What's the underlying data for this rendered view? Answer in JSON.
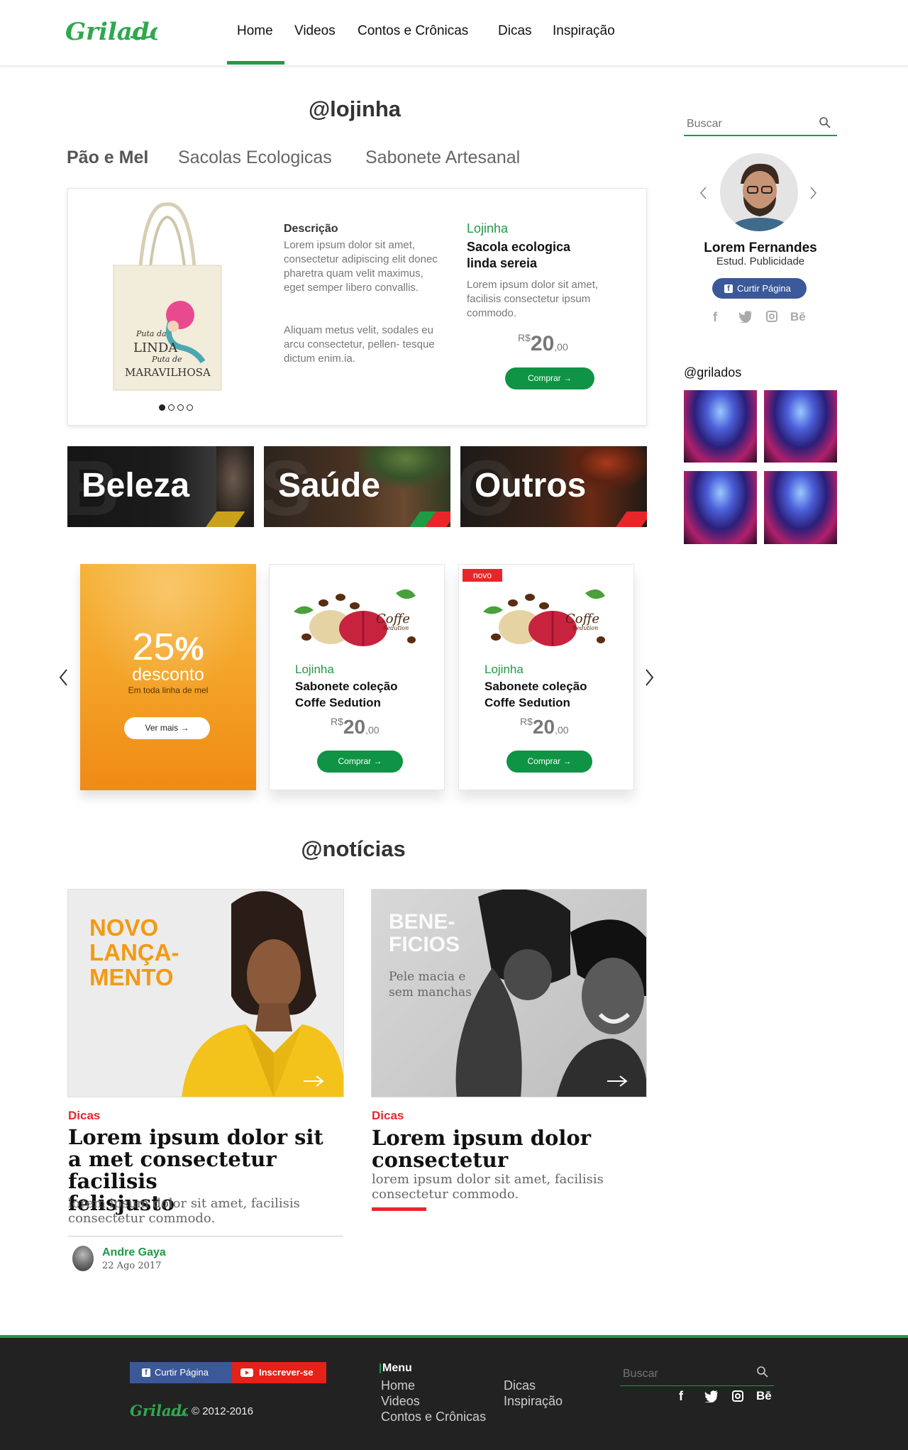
{
  "colors": {
    "brand_green": "#1e9b45",
    "button_green": "#0e9444",
    "accent_red": "#e8262a",
    "footer_bg": "#222222",
    "promo_orange": "#f29a1d"
  },
  "header": {
    "logo": "Grilados",
    "nav": [
      "Home",
      "Videos",
      "Contos e Crônicas",
      "Dicas",
      "Inspiração"
    ],
    "active": "Home"
  },
  "shop": {
    "title": "@lojinha",
    "tabs": [
      "Pão e Mel",
      "Sacolas Ecologicas",
      "Sabonete Artesanal"
    ],
    "featured": {
      "image_text": [
        "Puta da",
        "LINDA",
        "Puta de",
        "MARAVILHOSA"
      ],
      "desc_title": "Descrição",
      "desc_p1": "Lorem ipsum dolor sit amet, consectetur adipiscing elit donec pharetra quam velit maximus, eget semper libero convallis.",
      "desc_p2": "Aliquam metus velit, sodales eu arcu consectetur, pellen- tesque dictum enim.ia.",
      "store": "Lojinha",
      "name_line1": "Sacola ecologica",
      "name_line2": "linda sereia",
      "summary": "Lorem ipsum dolor sit amet, facilisis consectetur ipsum commodo.",
      "price_currency": "R$",
      "price_int": "20",
      "price_cents": ",00",
      "button": "Comprar →",
      "carousel_dots": 4,
      "carousel_active": 1
    },
    "categories": [
      {
        "label": "Beleza",
        "ghost": "B"
      },
      {
        "label": "Saúde",
        "ghost": "S"
      },
      {
        "label": "Outros",
        "ghost": "O"
      }
    ],
    "promo": {
      "percent": "25",
      "percent_sign": "%",
      "word": "desconto",
      "subtitle": "Em toda linha de mel",
      "button": "Ver mais →"
    },
    "products": [
      {
        "badge": "",
        "brand_line1": "Coffe",
        "brand_line2": "Sedution",
        "store": "Lojinha",
        "name_line1": "Sabonete coleção",
        "name_line2": "Coffe Sedution",
        "price_currency": "R$",
        "price_int": "20",
        "price_cents": ",00",
        "button": "Comprar →"
      },
      {
        "badge": "novo",
        "brand_line1": "Coffe",
        "brand_line2": "Sedution",
        "store": "Lojinha",
        "name_line1": "Sabonete coleção",
        "name_line2": "Coffe Sedution",
        "price_currency": "R$",
        "price_int": "20",
        "price_cents": ",00",
        "button": "Comprar →"
      }
    ]
  },
  "news": {
    "title": "@notícias",
    "items": [
      {
        "overlay_lines": [
          "NOVO",
          "LANÇA-",
          "MENTO"
        ],
        "tag": "Dicas",
        "title_lines": [
          "Lorem ipsum dolor sit",
          "a met consectetur facilisis",
          "felisjusto"
        ],
        "desc_lines": [
          "lorem ipsum dolor sit amet, facilisis",
          "consectetur commodo."
        ],
        "author": "Andre Gaya",
        "date": "22 Ago 2017"
      },
      {
        "overlay_lines": [
          "BENE-",
          "FICIOS"
        ],
        "overlay_sub_lines": [
          "Pele macia e",
          "sem manchas"
        ],
        "tag": "Dicas",
        "title_lines": [
          "Lorem ipsum dolor",
          "consectetur"
        ],
        "desc_lines": [
          "lorem ipsum dolor sit amet, facilisis",
          "consectetur commodo."
        ]
      }
    ]
  },
  "sidebar": {
    "search_placeholder": "Buscar",
    "profile": {
      "name": "Lorem Fernandes",
      "role": "Estud. Publicidade",
      "like_button": "Curtir Página",
      "socials": [
        "f",
        "twitter",
        "instagram",
        "Bē"
      ]
    },
    "instagram_title": "@grilados",
    "instagram_count": 4
  },
  "footer": {
    "like_button": "Curtir Página",
    "subscribe_button": "Inscrever-se",
    "logo": "Grilados",
    "copyright": "© 2012-2016",
    "menu_title": "Menu",
    "menu_col1": [
      "Home",
      "Videos",
      "Contos e Crônicas"
    ],
    "menu_col2": [
      "Dicas",
      "Inspiração"
    ],
    "search_placeholder": "Buscar",
    "socials": [
      "f",
      "twitter",
      "instagram",
      "Bē"
    ]
  }
}
